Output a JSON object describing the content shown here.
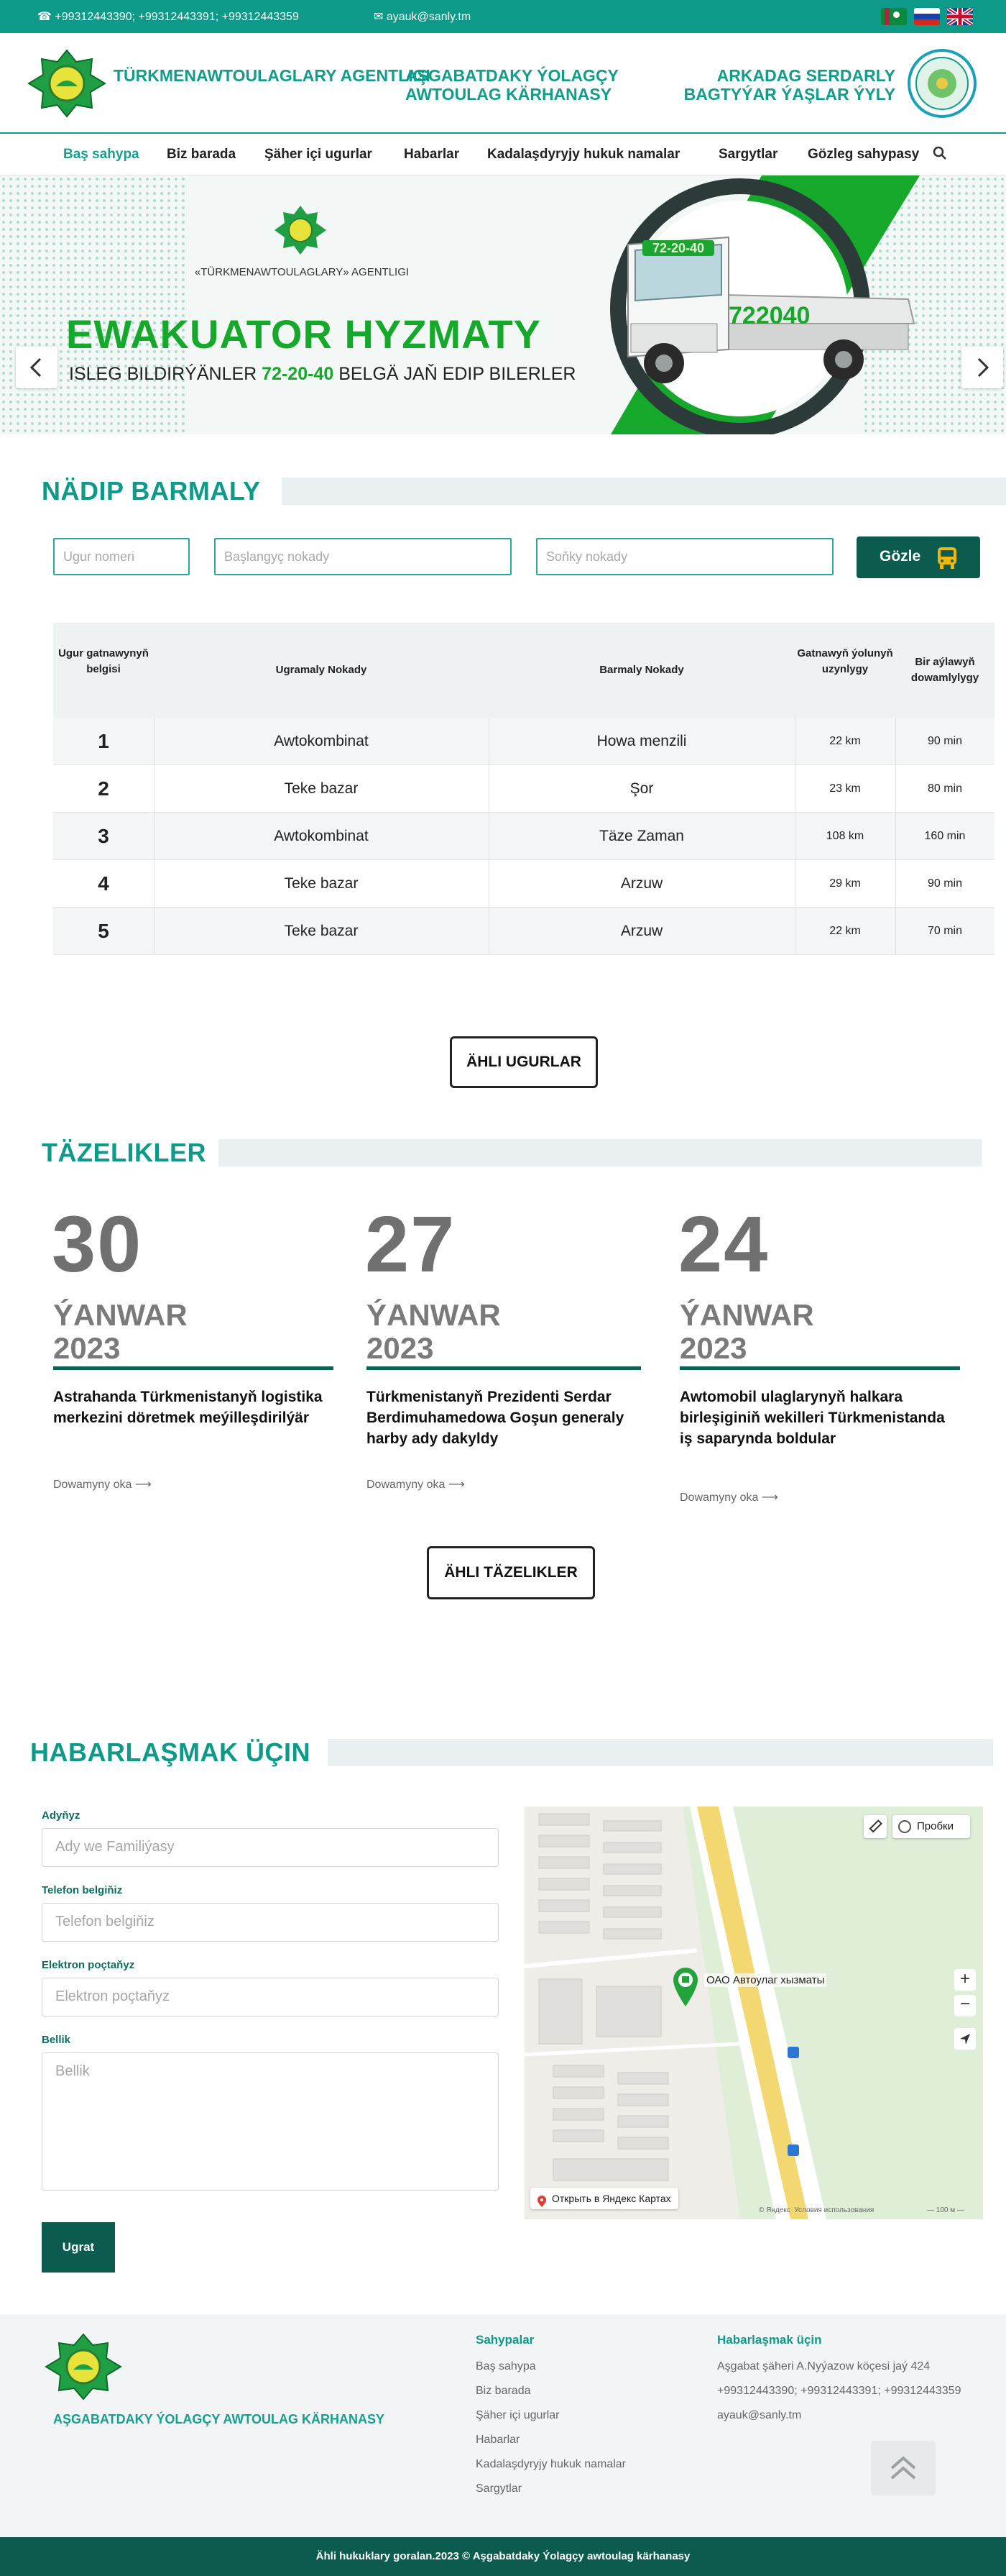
{
  "topbar": {
    "phones": "+99312443390; +99312443391; +99312443359",
    "email": "ayauk@sanly.tm"
  },
  "header": {
    "left_title": "TÜRKMENAWTOULAGLARY AGENTLIGI",
    "center_title_1": "AŞGABATDAKY ÝOLAGÇY",
    "center_title_2": "AWTOULAG KÄRHANASY",
    "right_title_1": "ARKADAG SERDARLY",
    "right_title_2": "BAGTYÝAR ÝAŞLAR ÝYLY"
  },
  "nav": {
    "items": [
      "Baş sahypa",
      "Biz barada",
      "Şäher içi ugurlar",
      "Habarlar",
      "Kadalaşdyryjy hukuk namalar",
      "Sargytlar",
      "Gözleg sahypasy"
    ]
  },
  "hero": {
    "agency": "«TÜRKMENAWTOULAGLARY» AGENTLIGI",
    "headline": "EWAKUATOR HYZMATY",
    "sub_pre": "ISLEG BILDIRÝÄNLER",
    "sub_phone": "72-20-40",
    "sub_post": "BELGÄ JAŇ EDIP BILERLER",
    "truck_number": "722040",
    "truck_top": "72-20-40"
  },
  "routes": {
    "title": "NÄDIP BARMALY",
    "placeholder_route": "Ugur nomeri",
    "placeholder_start": "Başlangyç nokady",
    "placeholder_end": "Soňky nokady",
    "search_label": "Gözle",
    "headers": [
      "Ugur gatnawynyň belgisi",
      "Ugramaly Nokady",
      "Barmaly Nokady",
      "Gatnawyň ýolunyň uzynlygy",
      "Bir aýlawyň dowamlylygy"
    ],
    "rows": [
      {
        "num": "1",
        "from": "Awtokombinat",
        "to": "Howa menzili",
        "length": "22 km",
        "duration": "90 min"
      },
      {
        "num": "2",
        "from": "Teke bazar",
        "to": "Şor",
        "length": "23 km",
        "duration": "80 min"
      },
      {
        "num": "3",
        "from": "Awtokombinat",
        "to": "Täze Zaman",
        "length": "108 km",
        "duration": "160 min"
      },
      {
        "num": "4",
        "from": "Teke bazar",
        "to": "Arzuw",
        "length": "29 km",
        "duration": "90 min"
      },
      {
        "num": "5",
        "from": "Teke bazar",
        "to": "Arzuw",
        "length": "22 km",
        "duration": "70 min"
      }
    ],
    "all_button": "ÄHLI UGURLAR"
  },
  "news": {
    "title": "TÄZELIKLER",
    "items": [
      {
        "day": "30",
        "month": "ÝANWAR",
        "year": "2023",
        "title": "Astrahanda Türkmenistanyň logistika merkezini döretmek meýilleşdirilýär",
        "more": "Dowamyny oka ⟶"
      },
      {
        "day": "27",
        "month": "ÝANWAR",
        "year": "2023",
        "title": "Türkmenistanyň Prezidenti Serdar Berdimuhamedowa Goşun generaly harby ady dakyldy",
        "more": "Dowamyny oka ⟶"
      },
      {
        "day": "24",
        "month": "ÝANWAR",
        "year": "2023",
        "title": "Awtomobil ulaglarynyň halkara birleşiginiň wekilleri Türkmenistanda iş saparynda boldular",
        "more": "Dowamyny oka ⟶"
      }
    ],
    "all_button": "ÄHLI TÄZELIKLER"
  },
  "contact": {
    "title": "HABARLAŞMAK ÜÇIN",
    "name_label": "Adyňyz",
    "name_placeholder": "Ady we Familiýasy",
    "phone_label": "Telefon belgiňiz",
    "phone_placeholder": "Telefon belgiňiz",
    "email_label": "Elektron poçtaňyz",
    "email_placeholder": "Elektron poçtaňyz",
    "message_label": "Bellik",
    "message_placeholder": "Bellik",
    "submit": "Ugrat",
    "map": {
      "traffic": "Пробки",
      "place_label": "ОАО Автоулаг хызматы",
      "open_in": "Открыть в Яндекс Картах",
      "yandex": "© Яндекс",
      "terms": "Условия использования",
      "scale": "100 м"
    }
  },
  "footer": {
    "brand": "AŞGABATDAKY ÝOLAGÇY AWTOULAG KÄRHANASY",
    "pages_title": "Sahypalar",
    "pages": [
      "Baş sahypa",
      "Biz barada",
      "Şäher içi ugurlar",
      "Habarlar",
      "Kadalaşdyryjy hukuk namalar",
      "Sargytlar"
    ],
    "contact_title": "Habarlaşmak üçin",
    "address": "Aşgabat şäheri A.Nyýazow köçesi jaý 424",
    "phones": "+99312443390; +99312443391; +99312443359",
    "email": "ayauk@sanly.tm",
    "copyright": "Ähli hukuklary goralan.2023 © Aşgabatdaky Ýolagçy awtoulag kärhanasy"
  },
  "colors": {
    "brand_green": "#0e9a89",
    "dark_green": "#0b5c4f",
    "hero_green": "#1aa531"
  }
}
